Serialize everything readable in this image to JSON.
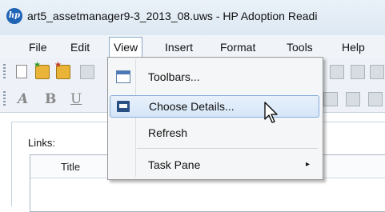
{
  "window": {
    "title": "art5_assetmanager9-3_2013_08.uws - HP Adoption Readi",
    "logo_text": "hp"
  },
  "menubar": {
    "items": [
      "File",
      "Edit",
      "View",
      "Insert",
      "Format",
      "Tools",
      "Help"
    ]
  },
  "toolbar": {
    "format_labels": [
      "A",
      "B",
      "U"
    ]
  },
  "content": {
    "links_label": "Links:",
    "table": {
      "columns": [
        "Title"
      ]
    }
  },
  "view_menu": {
    "items": [
      {
        "label": "Toolbars...",
        "icon": "toolbars-icon"
      },
      {
        "label": "Choose Details...",
        "icon": "choose-details-icon",
        "highlighted": true
      },
      {
        "label": "Refresh"
      },
      {
        "label": "Task Pane",
        "submenu": true,
        "arrow": "▸"
      }
    ]
  },
  "colors": {
    "menu_highlight": "#d5e6f8",
    "highlight_border": "#84acdd",
    "app_logo": "#1f63b5"
  }
}
